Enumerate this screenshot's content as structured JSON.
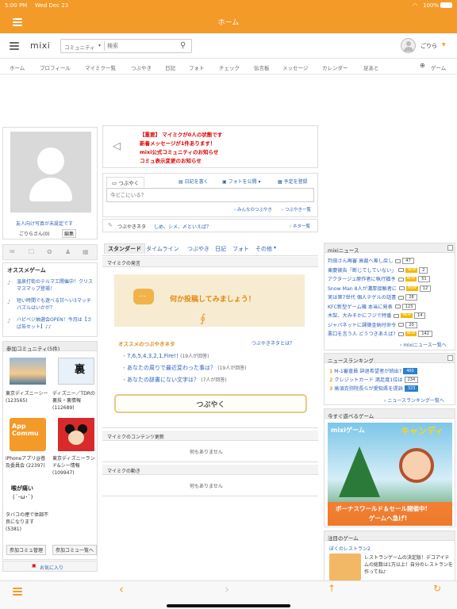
{
  "status": {
    "time": "5:00 PM",
    "date": "Wed Dec 23",
    "battery": "100%"
  },
  "app": {
    "title": "ホーム"
  },
  "header": {
    "logo": "mixi",
    "search_scope": "コミュニティ",
    "search_placeholder": "検索",
    "user_name": "ごりら"
  },
  "nav": [
    "ホーム",
    "プロフィール",
    "マイミク一覧",
    "つぶやき",
    "日記",
    "フォト",
    "チェック",
    "伝言板",
    "メッセージ",
    "カレンダー",
    "足あと",
    "ゲーム"
  ],
  "profile": {
    "photo_link": "友人向け写真が未設定です",
    "name": "ごりらさん(0)",
    "edit": "編集"
  },
  "games": {
    "title": "オススメゲーム",
    "items": [
      "温泉打街のテルマエ開催中！クリスマスマップ登場！",
      "短い時間でも遊べる甘〜い3マッチパズルはいかが？",
      "ハピベジ抽選会OPEN！今月は【さば缶セット】♪♪"
    ]
  },
  "communities": {
    "title": "参加コミュニティ(5件)",
    "items": [
      {
        "name": "東京ディズニーシー (123565)",
        "thumb": "東京ディズニーシー写真"
      },
      {
        "name": "ディズニー／TDRの裏技・裏情報 (112689)",
        "thumb": "裏"
      },
      {
        "name": "iPhoneアプリ@普及委員会 (22397)",
        "thumb": "App Commu"
      },
      {
        "name": "東京ディズニーランド&シー情報 (109947)",
        "thumb": "ミッキー"
      },
      {
        "name": "タバコの煙で体調不良になります (5381)",
        "thumb": "喉が痛い"
      }
    ],
    "manage": "参加コミュ管理",
    "list": "参加コミュ一覧へ",
    "favorites": "お気に入り"
  },
  "notices": [
    "【重要】 マイミクが0人の状態です",
    "新着メッセージが1件あります！",
    "mixi公式コミュニティのお知らせ",
    "コミュ表示変更のお知らせ"
  ],
  "tweet": {
    "tab": "つぶやく",
    "diary": "日記を書く",
    "photo": "フォトを公開",
    "schedule": "予定を登録",
    "placeholder": "今どこにいる？",
    "link_all": "みんなのつぶやき",
    "link_list": "つぶやき一覧",
    "neta_label": "つぶやきネタ",
    "neta_text": "しめ、シメ、〆といえば？",
    "neta_link": "ネタ一覧"
  },
  "feed_tabs": [
    "スタンダード",
    "タイムライン",
    "つぶやき",
    "日記",
    "フォト",
    "その他"
  ],
  "mymixi_posts": {
    "title": "マイミクの発言",
    "banner": "何か投稿してみましょう！",
    "neta_title": "オススメのつぶやきネタ",
    "neta_what": "つぶやきネタとは？",
    "neta": [
      {
        "text": "7,6,5,4,3,2,1,Fire!!",
        "count": "(19人が回答)"
      },
      {
        "text": "あなたの周りで最近変わった事は？",
        "count": "(19人が回答)"
      },
      {
        "text": "あなたの辞書にない文字は？",
        "count": "(7人が回答)"
      }
    ],
    "button": "つぶやく"
  },
  "contents_update": {
    "title": "マイミクのコンテンツ更新",
    "empty": "何もありません"
  },
  "mymixi_activity": {
    "title": "マイミクの動き",
    "empty": "何もありません"
  },
  "news": {
    "title": "mixiニュース",
    "items": [
      {
        "text": "羚田さん再審 高裁へ差し戻し",
        "count": "47",
        "new": false
      },
      {
        "text": "東慶被告「断じてしていない」",
        "count": "2",
        "new": true
      },
      {
        "text": "アクタージュ原作者に執行猶予",
        "count": "51",
        "new": true
      },
      {
        "text": "Snow Man 8人が濃厚接触者に",
        "count": "12",
        "new": true
      },
      {
        "text": "実は第7世代 個人テゲルの話書",
        "count": "28",
        "new": false
      },
      {
        "text": "KFC新型ゲーム機 本当に発表",
        "count": "123",
        "new": false
      },
      {
        "text": "木梨、大みそかにフジで特番",
        "count": "14",
        "new": true
      },
      {
        "text": "ジャパネットに課徴金納付命令",
        "count": "20",
        "new": false
      },
      {
        "text": "悪口を言う人 どうつきあえば?",
        "count": "142",
        "new": true
      }
    ],
    "more": "mixiニュース一覧へ"
  },
  "ranking": {
    "title": "ニュースランキング",
    "items": [
      {
        "rank": "1",
        "text": "M-1審査員 辞退希望者が続出?",
        "count": "400"
      },
      {
        "rank": "2",
        "text": "クレジットカード 満足度1位は",
        "count": "234"
      },
      {
        "rank": "3",
        "text": "高須克弥院長らが愛知県を提訴",
        "count": "323"
      }
    ],
    "more": "ニュースランキング一覧へ"
  },
  "playnow": {
    "title": "今すぐ遊べるゲーム",
    "banner_top": "mixiゲーム",
    "banner_name": "キャンディ",
    "banner_bottom": "ボーナスワールド＆セール開催中!",
    "banner_bottom2": "ゲームへ急げ!"
  },
  "featured": {
    "title": "注目のゲーム",
    "name": "ぼくのレストラン2",
    "desc": "レストランゲームの決定版！デコアイテムの総数は1万以上！自分のレストランを作ってね♪"
  },
  "colors": {
    "brand": "#f39a28",
    "link": "#2a5fb5",
    "alert": "#dd0000"
  }
}
